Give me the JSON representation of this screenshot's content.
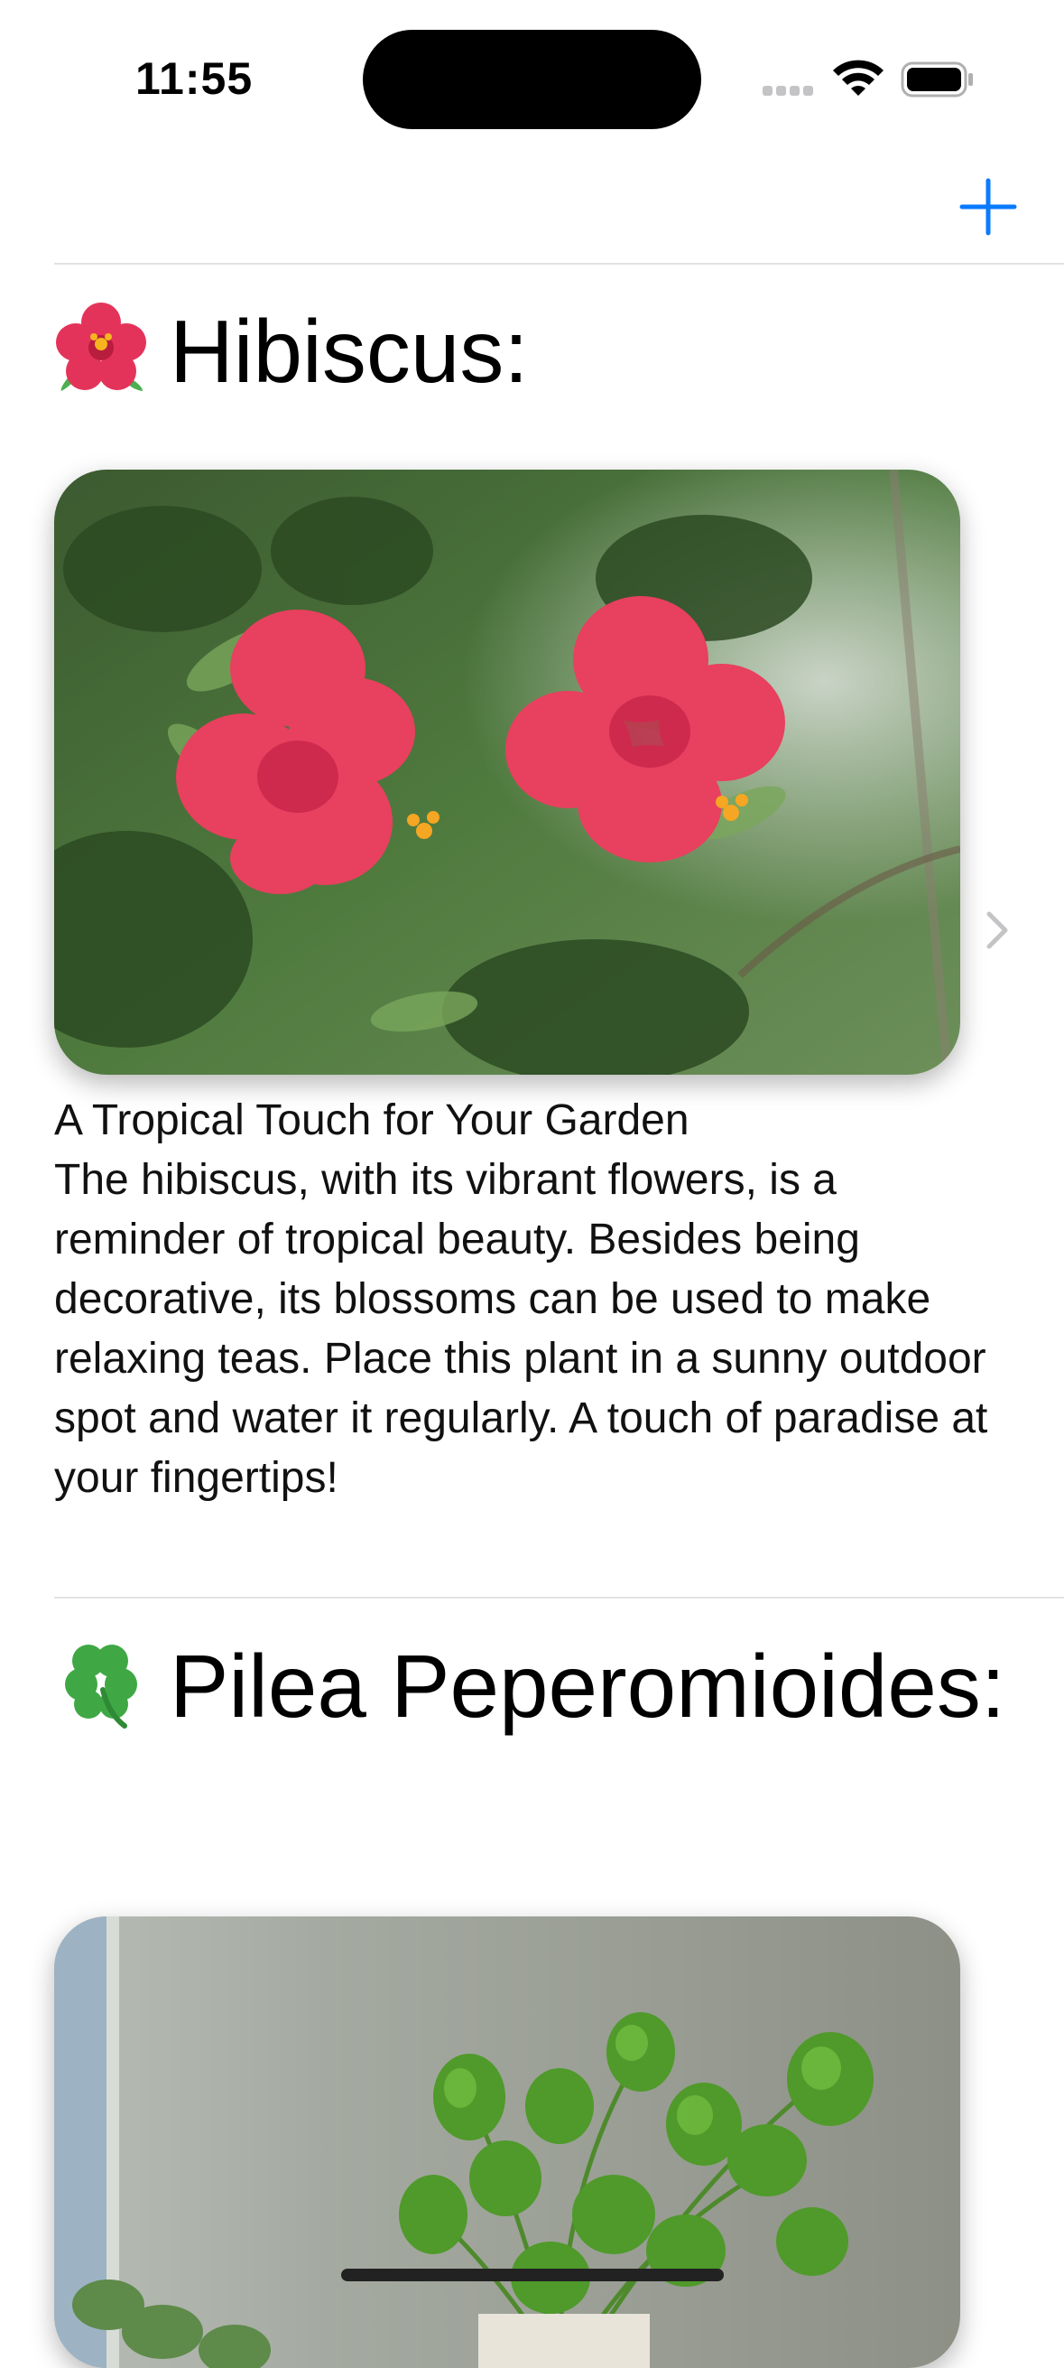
{
  "status_bar": {
    "time": "11:55"
  },
  "nav": {
    "add_icon": "plus-icon",
    "accent_color": "#0a7aff"
  },
  "sections": [
    {
      "emoji_icon": "hibiscus-emoji-icon",
      "title": "Hibiscus:",
      "subtitle": "A Tropical Touch for Your Garden",
      "body": "The hibiscus, with its vibrant flowers, is a reminder of tropical beauty. Besides being decorative, its blossoms can be used to make relaxing teas. Place this plant in a sunny outdoor spot and water it regularly. A touch of paradise at your fingertips!"
    },
    {
      "emoji_icon": "four-leaf-clover-emoji-icon",
      "title": "Pilea Peperomioides:"
    }
  ]
}
